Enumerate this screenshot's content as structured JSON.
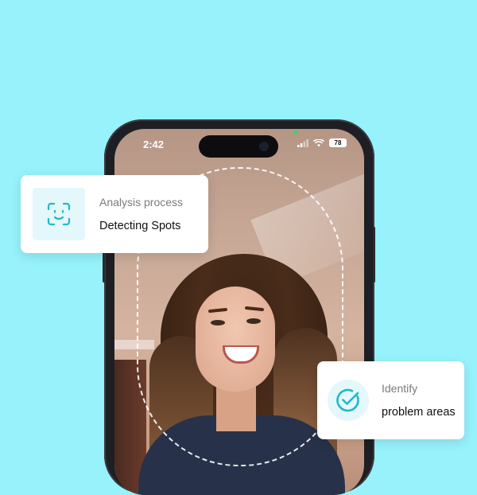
{
  "phone": {
    "status_time": "2:42",
    "battery": "78"
  },
  "cards": {
    "analysis": {
      "label": "Analysis process",
      "value": "Detecting Spots",
      "icon": "face-scan-icon"
    },
    "identify": {
      "label": "Identify",
      "value": "problem areas",
      "icon": "check-circle-icon"
    }
  },
  "colors": {
    "background": "#97f2fb",
    "accent": "#1fb8c9",
    "icon_bg": "#e4f8fb"
  }
}
